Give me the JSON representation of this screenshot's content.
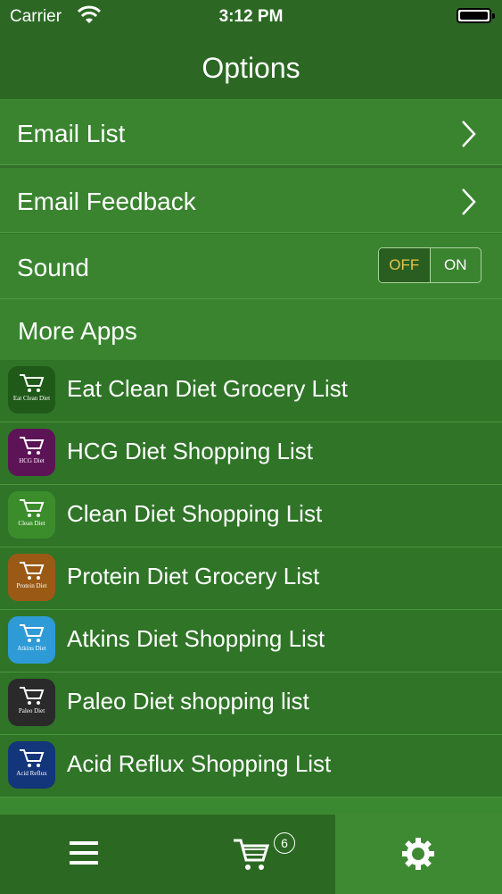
{
  "status_bar": {
    "carrier": "Carrier",
    "time": "3:12 PM"
  },
  "nav": {
    "title": "Options"
  },
  "options": {
    "email_list": "Email List",
    "email_feedback": "Email Feedback",
    "sound": {
      "label": "Sound",
      "off_label": "OFF",
      "on_label": "ON",
      "state": "OFF"
    }
  },
  "more_apps": {
    "header": "More Apps",
    "apps": [
      {
        "name": "Eat Clean Diet Grocery List",
        "icon_color": "#1f5a18",
        "icon_tag": "Eat Clean Diet"
      },
      {
        "name": "HCG Diet Shopping List",
        "icon_color": "#5c1457",
        "icon_tag": "HCG Diet"
      },
      {
        "name": "Clean Diet Shopping List",
        "icon_color": "#3b8d2c",
        "icon_tag": "Clean Diet"
      },
      {
        "name": "Protein Diet Grocery List",
        "icon_color": "#9a5a16",
        "icon_tag": "Protein Diet"
      },
      {
        "name": "Atkins Diet Shopping List",
        "icon_color": "#2e9bd6",
        "icon_tag": "Atkins Diet"
      },
      {
        "name": "Paleo Diet shopping list",
        "icon_color": "#2a2a2a",
        "icon_tag": "Paleo Diet"
      },
      {
        "name": "Acid Reflux Shopping List",
        "icon_color": "#13357a",
        "icon_tag": "Acid Reflux"
      }
    ]
  },
  "tab_bar": {
    "items": [
      {
        "icon": "menu-icon"
      },
      {
        "icon": "cart-icon",
        "badge": "6"
      },
      {
        "icon": "gear-icon",
        "active": true
      }
    ]
  }
}
